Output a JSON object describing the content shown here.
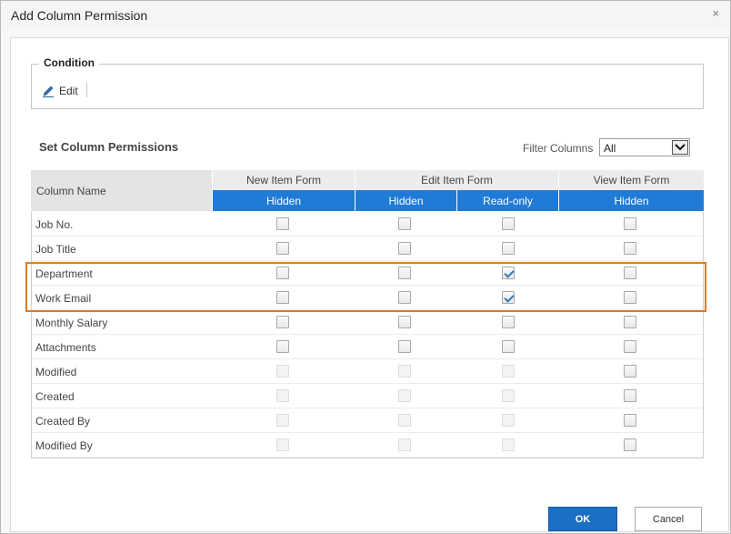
{
  "dialog": {
    "title": "Add Column Permission",
    "close_label": "×"
  },
  "condition": {
    "legend": "Condition",
    "edit_label": "Edit"
  },
  "permissions": {
    "title": "Set Column Permissions",
    "filter_label": "Filter Columns",
    "filter_value": "All"
  },
  "table": {
    "column_name_header": "Column Name",
    "groups": [
      "New Item Form",
      "Edit Item Form",
      "View Item Form"
    ],
    "sub_headers": [
      "Hidden",
      "Hidden",
      "Read-only",
      "Hidden"
    ],
    "rows": [
      {
        "name": "Job No.",
        "checks": [
          false,
          false,
          false,
          false
        ],
        "disabled": [
          false,
          false,
          false,
          false
        ]
      },
      {
        "name": "Job Title",
        "checks": [
          false,
          false,
          false,
          false
        ],
        "disabled": [
          false,
          false,
          false,
          false
        ]
      },
      {
        "name": "Department",
        "checks": [
          false,
          false,
          true,
          false
        ],
        "disabled": [
          false,
          false,
          false,
          false
        ]
      },
      {
        "name": "Work Email",
        "checks": [
          false,
          false,
          true,
          false
        ],
        "disabled": [
          false,
          false,
          false,
          false
        ]
      },
      {
        "name": "Monthly Salary",
        "checks": [
          false,
          false,
          false,
          false
        ],
        "disabled": [
          false,
          false,
          false,
          false
        ]
      },
      {
        "name": "Attachments",
        "checks": [
          false,
          false,
          false,
          false
        ],
        "disabled": [
          false,
          false,
          false,
          false
        ]
      },
      {
        "name": "Modified",
        "checks": [
          false,
          false,
          false,
          false
        ],
        "disabled": [
          true,
          true,
          true,
          false
        ]
      },
      {
        "name": "Created",
        "checks": [
          false,
          false,
          false,
          false
        ],
        "disabled": [
          true,
          true,
          true,
          false
        ]
      },
      {
        "name": "Created By",
        "checks": [
          false,
          false,
          false,
          false
        ],
        "disabled": [
          true,
          true,
          true,
          false
        ]
      },
      {
        "name": "Modified By",
        "checks": [
          false,
          false,
          false,
          false
        ],
        "disabled": [
          true,
          true,
          true,
          false
        ]
      }
    ]
  },
  "buttons": {
    "ok_label": "OK",
    "cancel_label": "Cancel"
  },
  "colors": {
    "accent": "#1f7bd6",
    "highlight": "#e07b1c",
    "ok_button": "#1c6fc4"
  },
  "icons": {
    "edit": "pencil-icon",
    "close": "close-icon",
    "dropdown": "chevron-down-icon"
  }
}
